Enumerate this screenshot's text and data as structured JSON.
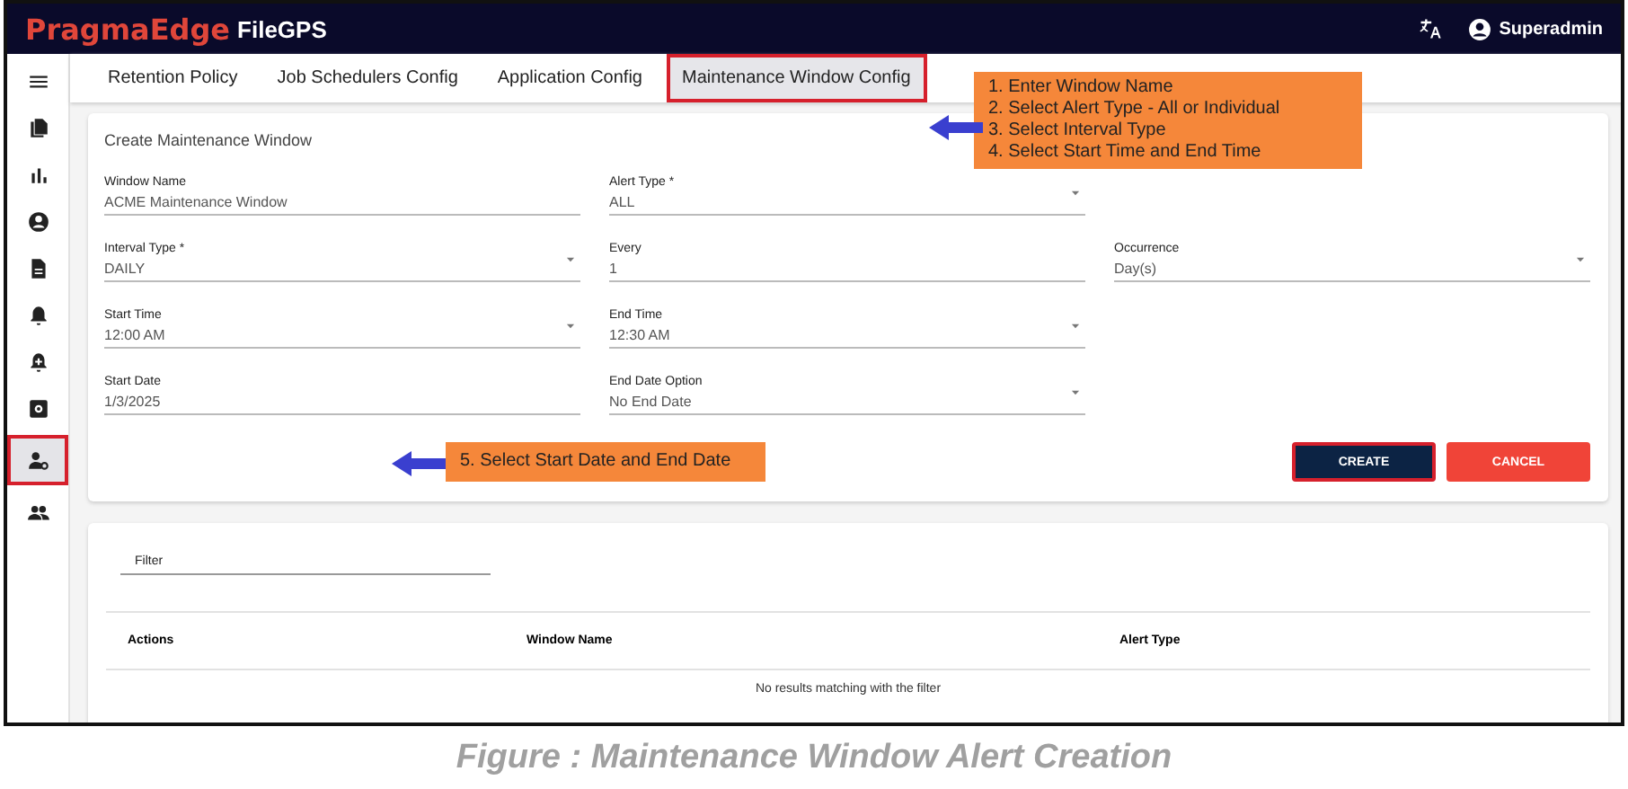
{
  "header": {
    "brand": "PragmaEdge",
    "product": "FileGPS",
    "user": "Superadmin"
  },
  "sidebar": {
    "items": [
      {
        "selected": false
      },
      {
        "selected": false
      },
      {
        "selected": false
      },
      {
        "selected": false
      },
      {
        "selected": false
      },
      {
        "selected": false
      },
      {
        "selected": false
      },
      {
        "selected": false
      },
      {
        "selected": true
      },
      {
        "selected": false
      }
    ]
  },
  "tabs": [
    {
      "label": "Retention Policy",
      "selected": false
    },
    {
      "label": "Job Schedulers Config",
      "selected": false
    },
    {
      "label": "Application Config",
      "selected": false
    },
    {
      "label": "Maintenance Window Config",
      "selected": true
    }
  ],
  "form": {
    "title": "Create Maintenance Window",
    "rows": [
      [
        {
          "label": "Window Name",
          "value": "ACME Maintenance Window",
          "kind": "text"
        },
        {
          "label": "Alert Type *",
          "value": "ALL",
          "kind": "select"
        }
      ],
      [
        {
          "label": "Interval Type *",
          "value": "DAILY",
          "kind": "select"
        },
        {
          "label": "Every",
          "value": "1",
          "kind": "text"
        },
        {
          "label": "Occurrence",
          "value": "Day(s)",
          "kind": "select"
        }
      ],
      [
        {
          "label": "Start Time",
          "value": "12:00 AM",
          "kind": "select"
        },
        {
          "label": "End Time",
          "value": "12:30 AM",
          "kind": "select"
        }
      ],
      [
        {
          "label": "Start Date",
          "value": "1/3/2025",
          "kind": "text"
        },
        {
          "label": "End Date Option",
          "value": "No End Date",
          "kind": "select"
        }
      ]
    ],
    "buttons": [
      {
        "label": "CREATE",
        "kind": "primary",
        "highlighted": true
      },
      {
        "label": "CANCEL",
        "kind": "danger",
        "highlighted": false
      }
    ]
  },
  "table": {
    "filter_placeholder": "Filter",
    "columns": [
      "Actions",
      "Window Name",
      "Alert Type"
    ],
    "empty_message": "No results matching with the filter"
  },
  "callouts": [
    {
      "lines": [
        "1. Enter Window Name",
        "2. Select Alert Type - All or Individual",
        "3. Select Interval Type",
        "4. Select Start Time and End Time"
      ]
    },
    {
      "lines": [
        "5. Select Start Date and End Date"
      ]
    }
  ],
  "caption": "Figure : Maintenance Window Alert Creation"
}
